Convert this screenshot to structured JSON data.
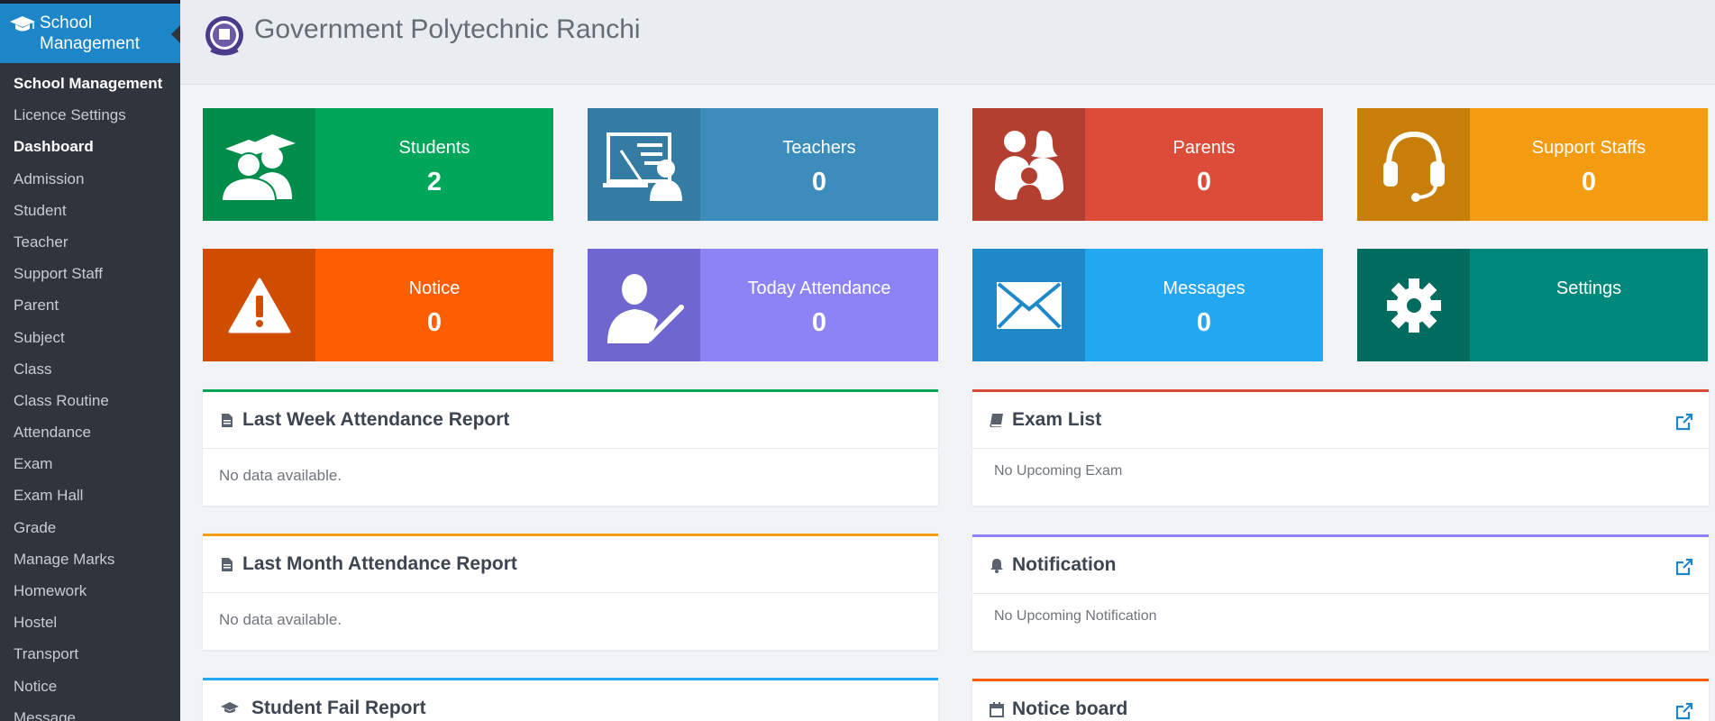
{
  "brand": {
    "label": "School Management"
  },
  "sidebar": {
    "items": [
      {
        "label": "School Management",
        "bold": true
      },
      {
        "label": "Licence Settings",
        "bold": false
      },
      {
        "label": "Dashboard",
        "bold": true
      },
      {
        "label": "Admission",
        "bold": false
      },
      {
        "label": "Student",
        "bold": false
      },
      {
        "label": "Teacher",
        "bold": false
      },
      {
        "label": "Support Staff",
        "bold": false
      },
      {
        "label": "Parent",
        "bold": false
      },
      {
        "label": "Subject",
        "bold": false
      },
      {
        "label": "Class",
        "bold": false
      },
      {
        "label": "Class Routine",
        "bold": false
      },
      {
        "label": "Attendance",
        "bold": false
      },
      {
        "label": "Exam",
        "bold": false
      },
      {
        "label": "Exam Hall",
        "bold": false
      },
      {
        "label": "Grade",
        "bold": false
      },
      {
        "label": "Manage Marks",
        "bold": false
      },
      {
        "label": "Homework",
        "bold": false
      },
      {
        "label": "Hostel",
        "bold": false
      },
      {
        "label": "Transport",
        "bold": false
      },
      {
        "label": "Notice",
        "bold": false
      },
      {
        "label": "Message",
        "bold": false
      }
    ]
  },
  "header": {
    "title": "Government Polytechnic Ranchi"
  },
  "tiles": [
    {
      "label": "Students",
      "value": "2",
      "icon": "students-icon",
      "color": "#00a65a",
      "dark": "#008d4c"
    },
    {
      "label": "Teachers",
      "value": "0",
      "icon": "teacher-board-icon",
      "color": "#3c8dbc",
      "dark": "#357ca5"
    },
    {
      "label": "Parents",
      "value": "0",
      "icon": "parents-icon",
      "color": "#dd4b39",
      "dark": "#b23f2f"
    },
    {
      "label": "Support Staffs",
      "value": "0",
      "icon": "headset-icon",
      "color": "#f39c12",
      "dark": "#c87f0a"
    },
    {
      "label": "Notice",
      "value": "0",
      "icon": "warning-icon",
      "color": "#ff5e00",
      "dark": "#d04d00"
    },
    {
      "label": "Today Attendance",
      "value": "0",
      "icon": "attendance-check-icon",
      "color": "#8c84f5",
      "dark": "#6f67cf"
    },
    {
      "label": "Messages",
      "value": "0",
      "icon": "envelope-icon",
      "color": "#22a7f0",
      "dark": "#1e88c8"
    },
    {
      "label": "Settings",
      "value": "",
      "icon": "gear-icon",
      "color": "#00897b",
      "dark": "#006b5f"
    }
  ],
  "panels": {
    "last_week": {
      "title": "Last Week Attendance Report",
      "body": "No data available.",
      "color": "#00a65a"
    },
    "last_month": {
      "title": "Last Month Attendance Report",
      "body": "No data available.",
      "color": "#f39c12"
    },
    "fail": {
      "title": "Student Fail Report",
      "color": "#22a7f0"
    },
    "exam": {
      "title": "Exam List",
      "body": "No Upcoming Exam",
      "color": "#dd4b39"
    },
    "notification": {
      "title": "Notification",
      "body": "No Upcoming Notification",
      "color": "#8c84f5"
    },
    "noticeboard": {
      "title": "Notice board",
      "color": "#ff5e00"
    }
  }
}
